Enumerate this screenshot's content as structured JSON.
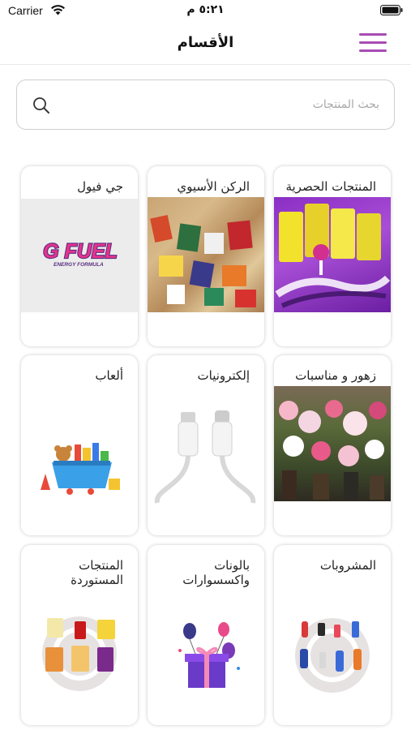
{
  "status_bar": {
    "carrier": "Carrier",
    "time": "٥:٢١ م"
  },
  "nav": {
    "title": "الأقسام"
  },
  "search": {
    "placeholder": "بحث المنتجات",
    "value": ""
  },
  "categories": [
    {
      "label": "المنتجات الحصرية",
      "image_icon": "exclusive-products-photo"
    },
    {
      "label": "الركن الأسيوي",
      "image_icon": "asian-snacks-photo"
    },
    {
      "label": "جي فيول",
      "image_icon": "gfuel-logo",
      "logo_text": "G FUEL",
      "logo_subtext": "ENERGY FORMULA"
    },
    {
      "label": "زهور و مناسبات",
      "image_icon": "flowers-photo"
    },
    {
      "label": "إلكترونيات",
      "image_icon": "usb-c-cable-icon"
    },
    {
      "label": "ألعاب",
      "image_icon": "toy-box-icon"
    },
    {
      "label": "المشروبات",
      "image_icon": "drinks-icon"
    },
    {
      "label": "بالونات واكسسوارات",
      "image_icon": "balloons-gift-icon"
    },
    {
      "label": "المنتجات المستوردة",
      "image_icon": "imported-snacks-icon"
    }
  ],
  "colors": {
    "accent": "#a94bb4",
    "gfuel_pink": "#e8328c"
  }
}
